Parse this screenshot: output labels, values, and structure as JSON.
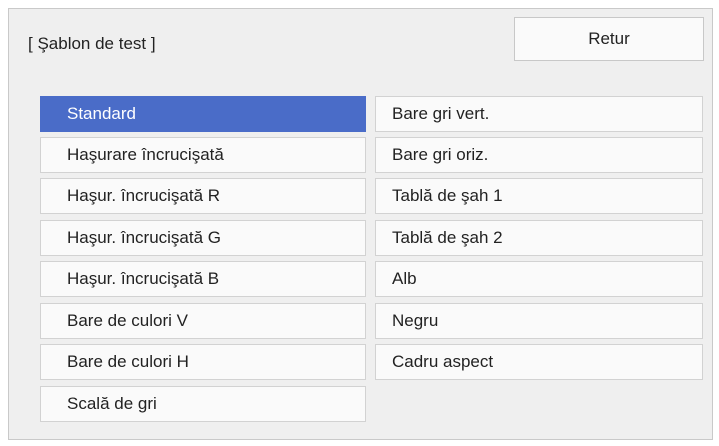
{
  "dialog": {
    "title": "[ Şablon de test ]",
    "back_label": "Retur"
  },
  "left_items": [
    {
      "label": "Standard",
      "selected": true
    },
    {
      "label": "Haşurare încrucişată",
      "selected": false
    },
    {
      "label": "Haşur. încrucişată R",
      "selected": false
    },
    {
      "label": "Haşur. încrucişată G",
      "selected": false
    },
    {
      "label": "Haşur. încrucişată B",
      "selected": false
    },
    {
      "label": "Bare de culori V",
      "selected": false
    },
    {
      "label": "Bare de culori H",
      "selected": false
    },
    {
      "label": "Scală de gri",
      "selected": false
    }
  ],
  "right_items": [
    {
      "label": "Bare gri vert."
    },
    {
      "label": "Bare gri oriz."
    },
    {
      "label": "Tablă de şah 1"
    },
    {
      "label": "Tablă de şah 2"
    },
    {
      "label": "Alb"
    },
    {
      "label": "Negru"
    },
    {
      "label": "Cadru aspect"
    }
  ],
  "colors": {
    "selection": "#4a6cc8",
    "panel": "#efefef",
    "item": "#fafafa"
  }
}
